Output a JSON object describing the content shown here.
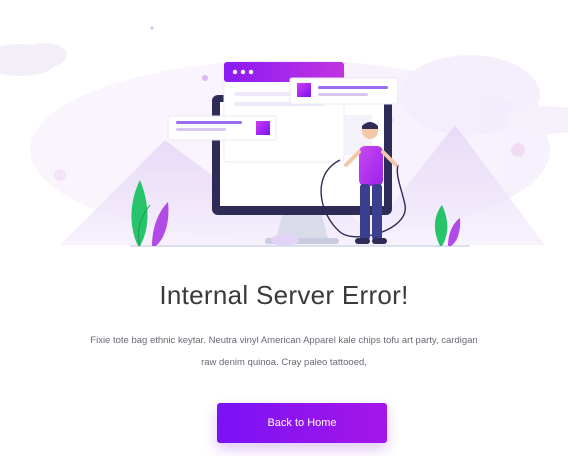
{
  "error": {
    "title": "Internal Server Error!",
    "description_line1": "Fixie tote bag ethnic keytar. Neutra vinyl American Apparel kale chips tofu art party, cardigan",
    "description_line2": "raw denim quinoa. Cray paleo tattooed,"
  },
  "actions": {
    "back_home_label": "Back to Home"
  },
  "theme": {
    "accent_start": "#7a12f5",
    "accent_end": "#a516e8",
    "title_color": "#3a3a3a",
    "text_color": "#666a73",
    "plant_green": "#27c46b"
  },
  "illustration": {
    "subject": "server-error-illustration",
    "icons": [
      "browser-window-icon",
      "monitor-icon",
      "person-figure-icon",
      "plant-icon",
      "cloud-icon"
    ]
  }
}
